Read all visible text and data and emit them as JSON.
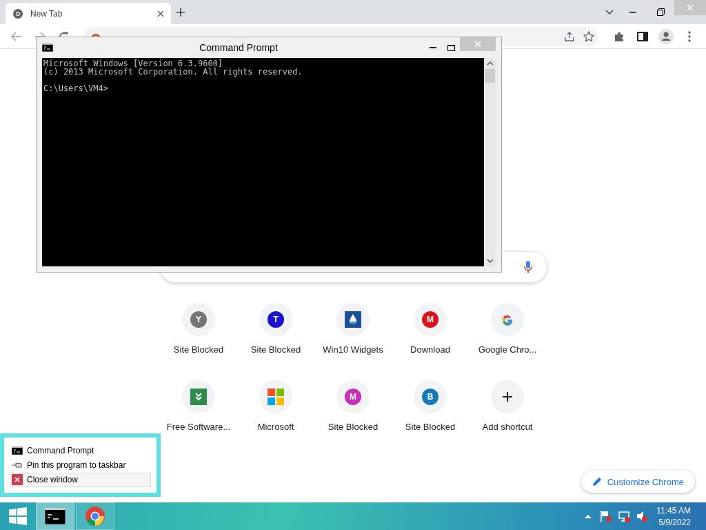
{
  "browser": {
    "tab": {
      "title": "New Tab",
      "selected": true
    }
  },
  "shortcuts": [
    {
      "label": "Site Blocked",
      "kind": "letter",
      "letter": "Y",
      "color": "#757575"
    },
    {
      "label": "Site Blocked",
      "kind": "letter",
      "letter": "T",
      "color": "#1a12d0"
    },
    {
      "label": "Win10 Widgets",
      "kind": "drop"
    },
    {
      "label": "Download",
      "kind": "mega",
      "letter": "M",
      "color": "#d9151b"
    },
    {
      "label": "Google Chro...",
      "kind": "google"
    },
    {
      "label": "Free Software...",
      "kind": "chevron"
    },
    {
      "label": "Microsoft",
      "kind": "windows"
    },
    {
      "label": "Site Blocked",
      "kind": "letter",
      "letter": "M",
      "color": "#c72fb8"
    },
    {
      "label": "Site Blocked",
      "kind": "letter",
      "letter": "B",
      "color": "#1479b5"
    },
    {
      "label": "Add shortcut",
      "kind": "add"
    }
  ],
  "customize_button": "Customize Chrome",
  "console_window": {
    "title": "Command Prompt",
    "blocks": [
      [
        "Microsoft Windows [Version 6.3.9600]",
        "(c) 2013 Microsoft Corporation. All rights reserved."
      ],
      [
        "C:\\Users\\VM4>"
      ]
    ]
  },
  "jump_list": [
    {
      "label": "Command Prompt",
      "kind": "console",
      "selected": false
    },
    {
      "label": "Pin this program to taskbar",
      "kind": "pin",
      "selected": false
    },
    {
      "label": "Close window",
      "kind": "close",
      "selected": true
    }
  ],
  "taskbar": {
    "apps": [
      {
        "kind": "console",
        "selected": true
      },
      {
        "kind": "chrome",
        "selected": false
      }
    ],
    "time": "11:45 AM",
    "date": "5/9/2022"
  }
}
